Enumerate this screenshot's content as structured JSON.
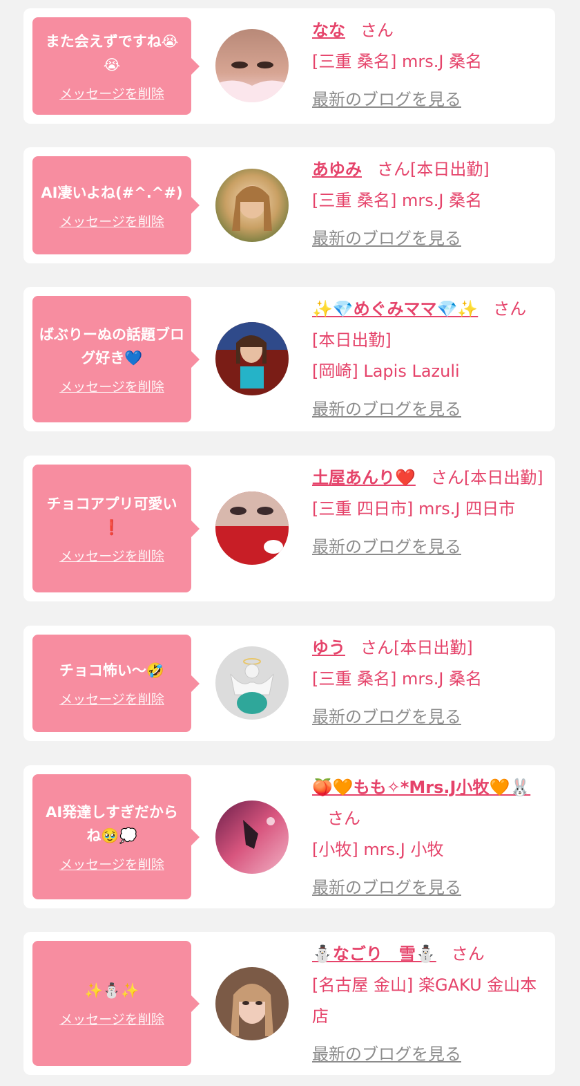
{
  "colors": {
    "page_bg": "#f2f2f2",
    "card_bg": "#ffffff",
    "bubble_bg": "#f78da0",
    "accent_pink": "#e5436a",
    "link_gray": "#8c8c8c"
  },
  "common": {
    "delete_label": "メッセージを削除",
    "san_label": "さん",
    "blog_label": "最新のブログを見る"
  },
  "entries": [
    {
      "message": "また会えずですね😭😭",
      "name": "なな",
      "status": "",
      "shop": "[三重 桑名] mrs.J 桑名"
    },
    {
      "message": "AI凄いよね(#^.^#)",
      "name": "あゆみ",
      "status": "[本日出勤]",
      "shop": "[三重 桑名] mrs.J 桑名"
    },
    {
      "message": "ばぶりーぬの話題ブログ好き💙",
      "name": "✨💎めぐみママ💎✨",
      "status": "[本日出勤]",
      "shop": "[岡崎] Lapis Lazuli"
    },
    {
      "message": "チョコアプリ可愛い❗️",
      "name": "土屋あんり❤️",
      "status": "[本日出勤]",
      "shop": "[三重 四日市] mrs.J 四日市"
    },
    {
      "message": "チョコ怖い〜🤣",
      "name": "ゆう",
      "status": "[本日出勤]",
      "shop": "[三重 桑名] mrs.J 桑名"
    },
    {
      "message": "AI発達しすぎだからね🥹💭",
      "name": "🍑🧡もも✧*Mrs.J小牧🧡🐰",
      "status": "",
      "shop": "[小牧] mrs.J 小牧"
    },
    {
      "message": "✨⛄️✨",
      "name": "⛄️なごり　雪⛄️",
      "status": "",
      "shop": "[名古屋 金山] 楽GAKU 金山本店"
    }
  ]
}
